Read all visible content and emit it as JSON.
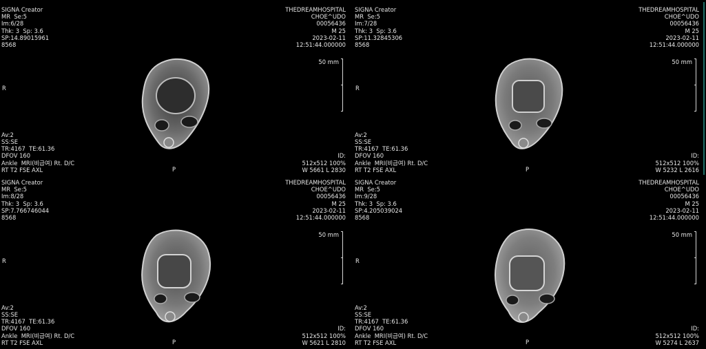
{
  "viewports": [
    {
      "top_left": [
        "SIGNA Creator",
        "MR  Se:5",
        "Im:6/28",
        "Thk: 3  Sp: 3.6",
        "SP:14.89015961",
        "8568"
      ],
      "top_right": [
        "THEDREAMHOSPITAL",
        "CHOE^UDO",
        "00056436",
        "M 25",
        "2023-02-11",
        "12:51:44.000000"
      ],
      "bottom_left": [
        "Av:2",
        "SS:SE",
        "TR:4167  TE:61.36",
        "DFOV 160",
        "Ankle  MRI(비급여) Rt. D/C",
        "RT T2 FSE AXL"
      ],
      "bottom_right": [
        "ID:",
        "512x512 100%",
        "W 5661 L 2830"
      ],
      "orientation_left": "R",
      "orientation_bottom": "P",
      "scale_label": "50 mm"
    },
    {
      "top_left": [
        "SIGNA Creator",
        "MR  Se:5",
        "Im:7/28",
        "Thk: 3  Sp: 3.6",
        "SP:11.32845306",
        "8568"
      ],
      "top_right": [
        "THEDREAMHOSPITAL",
        "CHOE^UDO",
        "00056436",
        "M 25",
        "2023-02-11",
        "12:51:44.000000"
      ],
      "bottom_left": [
        "Av:2",
        "SS:SE",
        "TR:4167  TE:61.36",
        "DFOV 160",
        "Ankle  MRI(비급여) Rt. D/C",
        "RT T2 FSE AXL"
      ],
      "bottom_right": [
        "ID:",
        "512x512 100%",
        "W 5232 L 2616"
      ],
      "orientation_left": "R",
      "orientation_bottom": "P",
      "scale_label": "50 mm"
    },
    {
      "top_left": [
        "SIGNA Creator",
        "MR  Se:5",
        "Im:8/28",
        "Thk: 3  Sp: 3.6",
        "SP:7.766746044",
        "8568"
      ],
      "top_right": [
        "THEDREAMHOSPITAL",
        "CHOE^UDO",
        "00056436",
        "M 25",
        "2023-02-11",
        "12:51:44.000000"
      ],
      "bottom_left": [
        "Av:2",
        "SS:SE",
        "TR:4167  TE:61.36",
        "DFOV 160",
        "Ankle  MRI(비급여) Rt. D/C",
        "RT T2 FSE AXL"
      ],
      "bottom_right": [
        "ID:",
        "512x512 100%",
        "W 5621 L 2810"
      ],
      "orientation_left": "R",
      "orientation_bottom": "P",
      "scale_label": "50 mm"
    },
    {
      "top_left": [
        "SIGNA Creator",
        "MR  Se:5",
        "Im:9/28",
        "Thk: 3  Sp: 3.6",
        "SP:4.205039024",
        "8568"
      ],
      "top_right": [
        "THEDREAMHOSPITAL",
        "CHOE^UDO",
        "00056436",
        "M 25",
        "2023-02-11",
        "12:51:44.000000"
      ],
      "bottom_left": [
        "Av:2",
        "SS:SE",
        "TR:4167  TE:61.36",
        "DFOV 160",
        "Ankle  MRI(비급여) Rt. D/C",
        "RT T2 FSE AXL"
      ],
      "bottom_right": [
        "ID:",
        "512x512 100%",
        "W 5274 L 2637"
      ],
      "orientation_left": "R",
      "orientation_bottom": "P",
      "scale_label": "50 mm"
    }
  ]
}
